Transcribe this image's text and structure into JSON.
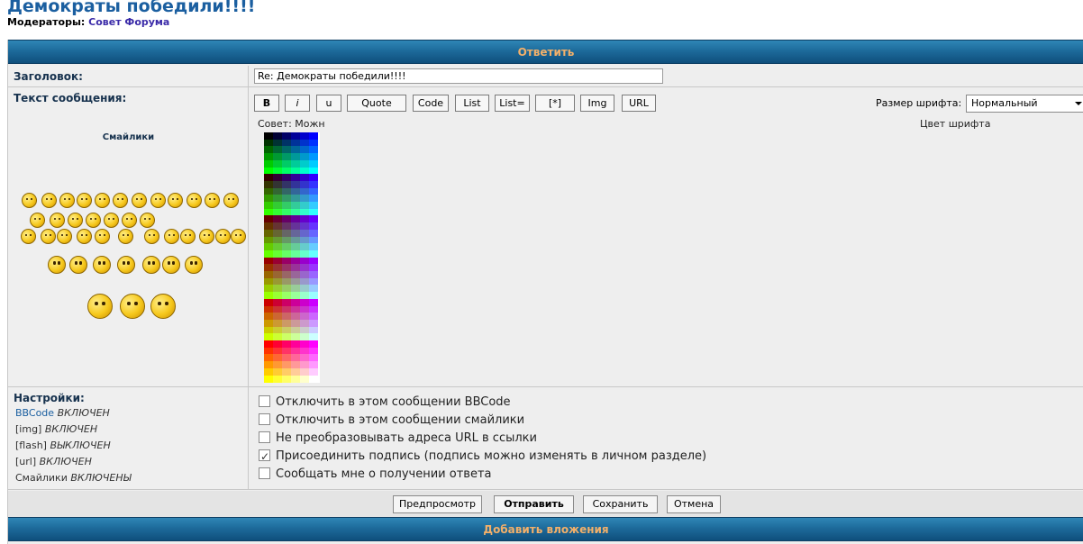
{
  "topic": {
    "title": "Демократы победили!!!!",
    "moderators_label": "Модераторы:",
    "moderators_link": "Совет Форума"
  },
  "reply_header": "Ответить",
  "subject": {
    "label": "Заголовок:",
    "value": "Re: Демократы победили!!!!"
  },
  "message": {
    "label": "Текст сообщения:",
    "smilies_title": "Смайлики"
  },
  "toolbar": {
    "buttons": [
      "B",
      "i",
      "u",
      "Quote",
      "Code",
      "List",
      "List=",
      "[*]",
      "Img",
      "URL"
    ],
    "font_size_label": "Размер шрифта:",
    "font_size_value": "Нормальный",
    "hint": "Совет: Можн",
    "font_color_label": "Цвет шрифта"
  },
  "settings": {
    "label": "Настройки:",
    "lines": [
      {
        "key": "BBCode",
        "state": "ВКЛЮЧЕН"
      },
      {
        "key": "[img]",
        "state": "ВКЛЮЧЕН"
      },
      {
        "key": "[flash]",
        "state": "ВЫКЛЮЧЕН"
      },
      {
        "key": "[url]",
        "state": "ВКЛЮЧЕН"
      },
      {
        "key": "Смайлики",
        "state": "ВКЛЮЧЕНЫ"
      }
    ],
    "options": [
      {
        "label": "Отключить в этом сообщении BBCode",
        "checked": false
      },
      {
        "label": "Отключить в этом сообщении смайлики",
        "checked": false
      },
      {
        "label": "Не преобразовывать адреса URL в ссылки",
        "checked": false
      },
      {
        "label": "Присоединить подпись (подпись можно изменять в личном разделе)",
        "checked": true
      },
      {
        "label": "Сообщать мне о получении ответа",
        "checked": false
      }
    ]
  },
  "actions": {
    "preview": "Предпросмотр",
    "submit": "Отправить",
    "save": "Сохранить",
    "cancel": "Отмена"
  },
  "attachments_header": "Добавить вложения",
  "colors": {
    "accent": "#1b5fa0",
    "header_text": "#f3b06a",
    "link": "#3a2aa8"
  }
}
